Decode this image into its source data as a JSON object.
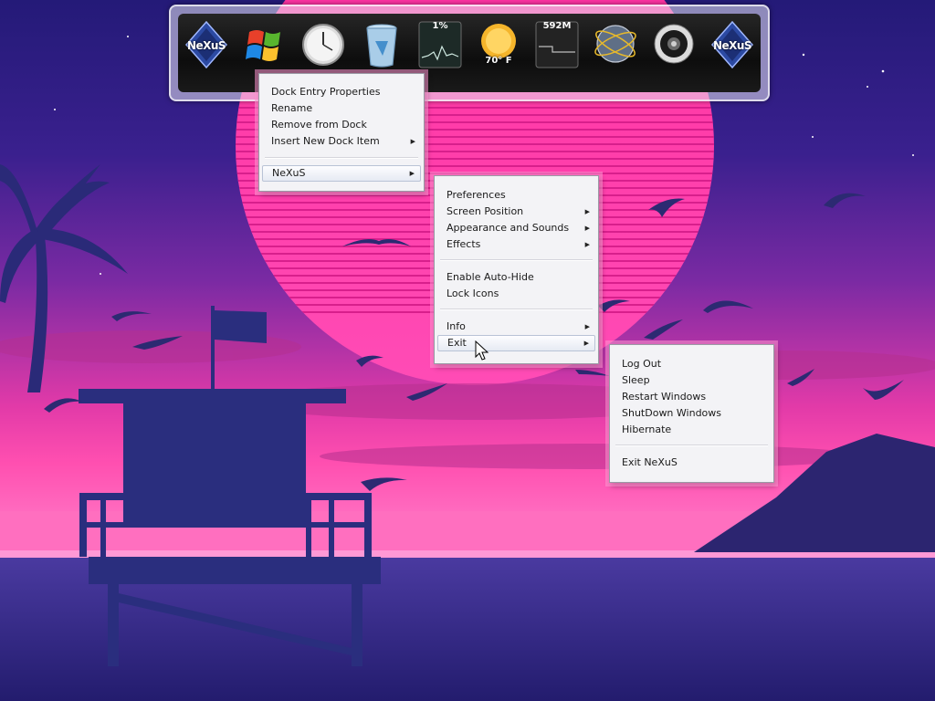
{
  "dock": {
    "items": [
      {
        "name": "nexus-logo-icon",
        "label": "NeXuS"
      },
      {
        "name": "windows-flag-icon",
        "label": ""
      },
      {
        "name": "clock-icon",
        "label": ""
      },
      {
        "name": "recycle-bin-icon",
        "label": ""
      },
      {
        "name": "cpu-monitor-icon",
        "label": "1%"
      },
      {
        "name": "weather-icon",
        "label": "70° F"
      },
      {
        "name": "memory-monitor-icon",
        "label": "592M"
      },
      {
        "name": "network-globe-icon",
        "label": ""
      },
      {
        "name": "speaker-icon",
        "label": ""
      },
      {
        "name": "nexus-logo-icon",
        "label": "NeXuS"
      }
    ]
  },
  "context_menu": {
    "items": [
      "Dock Entry Properties",
      "Rename",
      "Remove from Dock",
      "Insert New Dock Item"
    ],
    "nexus": "NeXuS"
  },
  "nexus_menu": {
    "group1": [
      "Preferences",
      "Screen Position",
      "Appearance and Sounds",
      "Effects"
    ],
    "group2": [
      "Enable Auto-Hide",
      "Lock Icons"
    ],
    "group3": [
      "Info",
      "Exit"
    ]
  },
  "exit_menu": {
    "items": [
      "Log Out",
      "Sleep",
      "Restart Windows",
      "ShutDown Windows",
      "Hibernate"
    ],
    "exit": "Exit NeXuS"
  },
  "colors": {
    "sun": "#ff3fa0",
    "sky_top": "#241a78",
    "menu_bg": "#f3f3f6",
    "highlight_border": "#b9c3d6"
  }
}
